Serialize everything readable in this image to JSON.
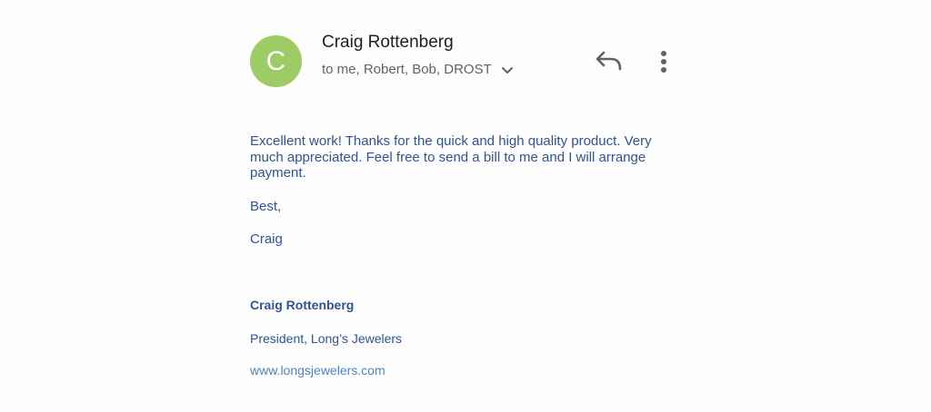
{
  "sender": {
    "avatar_letter": "C",
    "avatar_color": "#9ccc65",
    "name": "Craig Rottenberg",
    "recipients": "to me, Robert, Bob, DROST"
  },
  "actions": {
    "reply_icon": "reply-icon",
    "more_icon": "more-vert-icon",
    "expand_icon": "chevron-down-icon"
  },
  "message": {
    "paragraph": "Excellent work!  Thanks for the quick and high quality product. Very much appreciated.  Feel free to send a bill to me and I will arrange payment.",
    "closing": "Best,",
    "signoff": "Craig"
  },
  "signature": {
    "name": "Craig Rottenberg",
    "title": "President, Long’s Jewelers",
    "website": "www.longsjewelers.com"
  },
  "colors": {
    "body_text": "#2f5496",
    "link": "#4a86c8",
    "icon": "#5f6368"
  }
}
